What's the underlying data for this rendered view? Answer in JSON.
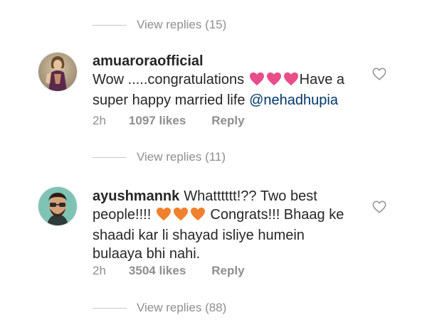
{
  "thread": {
    "top_replies": {
      "label": "View replies (15)"
    },
    "comments": [
      {
        "username": "amuaroraofficial",
        "text_before": "Wow .....congratulations",
        "emoji": [
          "pink-heart",
          "pink-heart",
          "pink-heart"
        ],
        "text_after": "Have a super happy married life",
        "mention": "@nehadhupia",
        "time": "2h",
        "likes": "1097 likes",
        "reply": "Reply",
        "replies_label": "View replies (11)",
        "heart_color": "#e94d8a"
      },
      {
        "username": "ayushmannk",
        "text_before": "Whatttttt!?? Two best people!!!!",
        "emoji": [
          "orange-heart",
          "orange-heart",
          "orange-heart"
        ],
        "text_after": "Congrats!!! Bhaag ke shaadi kar li shayad isliye humein bulaaya bhi nahi.",
        "mention": "",
        "time": "2h",
        "likes": "3504 likes",
        "reply": "Reply",
        "replies_label": "View replies (88)",
        "heart_color": "#f0812e"
      }
    ]
  },
  "colors": {
    "text": "#262626",
    "muted": "#8e8e8e",
    "mention": "#00376b",
    "divider": "#c7c7c7"
  }
}
